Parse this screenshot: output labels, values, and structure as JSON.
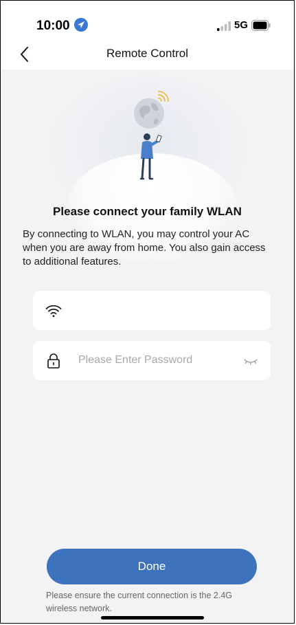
{
  "status_bar": {
    "time": "10:00",
    "network": "5G",
    "location_icon": "location-arrow-icon",
    "signal_icon": "cellular-signal-icon",
    "battery_icon": "battery-icon"
  },
  "nav": {
    "title": "Remote Control",
    "back_icon": "chevron-left-icon"
  },
  "hero": {
    "illustration": "person-with-phone-and-globe"
  },
  "headline": "Please connect your family WLAN",
  "description": "By connecting to WLAN, you may control your AC when you are away from home. You also gain access to additional features.",
  "wifi_field": {
    "icon": "wifi-icon",
    "value": ""
  },
  "password_field": {
    "icon": "lock-icon",
    "placeholder": "Please Enter Password",
    "value": "",
    "toggle_icon": "eye-closed-icon"
  },
  "done_label": "Done",
  "footnote": "Please ensure the current connection is the 2.4G wireless network.",
  "colors": {
    "accent": "#3d73bd",
    "background": "#f3f3f5",
    "surface": "#ffffff",
    "location_badge": "#3a78d6",
    "wifi_signal_accent": "#f0b840"
  }
}
